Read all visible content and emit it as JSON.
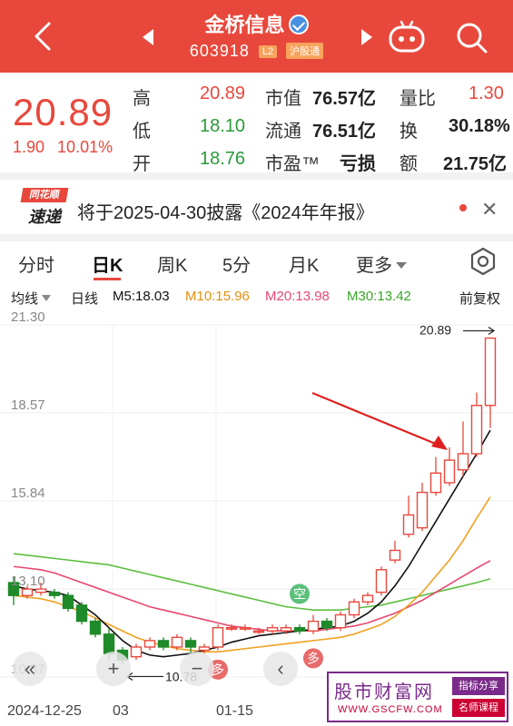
{
  "header": {
    "stock_name": "金桥信息",
    "stock_code": "603918",
    "level_tag": "L2",
    "connect_tag": "沪股通"
  },
  "quote": {
    "price": "20.89",
    "change": "1.90",
    "change_pct": "10.01%",
    "rows": [
      {
        "l1": "高",
        "v1": "20.89",
        "l2": "市值",
        "v2": "76.57亿",
        "l3": "量比",
        "v3": "1.30"
      },
      {
        "l1": "低",
        "v1": "18.10",
        "l2": "流通",
        "v2": "76.51亿",
        "l3": "换",
        "v3": "30.18%"
      },
      {
        "l1": "开",
        "v1": "18.76",
        "l2": "市盈™",
        "v2": "亏损",
        "l3": "额",
        "v3": "21.75亿"
      }
    ]
  },
  "news": {
    "logo_top": "同花顺",
    "logo_bottom": "速递",
    "text": "将于2025-04-30披露《2024年年报》"
  },
  "tabs": [
    "分时",
    "日K",
    "周K",
    "5分",
    "月K",
    "更多"
  ],
  "ma_legend": {
    "mode": "均线",
    "period": "日线",
    "m5": "M5:18.03",
    "m10": "M10:15.96",
    "m20": "M20:13.98",
    "m30": "M30:13.42",
    "adjust": "前复权"
  },
  "colors": {
    "up": "#e8483c",
    "down": "#1f8a2a",
    "m5": "#111111",
    "m10": "#f0a020",
    "m20": "#e84870",
    "m30": "#5cbf40"
  },
  "chart_data": {
    "type": "candlestick",
    "y_ticks": [
      "21.30",
      "18.57",
      "15.84",
      "13.10",
      "10.37"
    ],
    "ylim": [
      10.37,
      21.3
    ],
    "high_label": "20.89",
    "low_label": "10.78",
    "x_labels": [
      "2024-12-25",
      "03",
      "01-15"
    ],
    "markers": [
      "空",
      "多",
      "多"
    ],
    "candles": [
      {
        "o": 13.3,
        "c": 12.9,
        "h": 13.5,
        "l": 12.6
      },
      {
        "o": 12.9,
        "c": 13.1,
        "h": 13.2,
        "l": 12.8
      },
      {
        "o": 13.0,
        "c": 13.1,
        "h": 13.3,
        "l": 12.9
      },
      {
        "o": 13.0,
        "c": 12.9,
        "h": 13.1,
        "l": 12.8
      },
      {
        "o": 12.9,
        "c": 12.5,
        "h": 13.0,
        "l": 12.4
      },
      {
        "o": 12.6,
        "c": 12.1,
        "h": 12.7,
        "l": 12.0
      },
      {
        "o": 12.1,
        "c": 11.7,
        "h": 12.2,
        "l": 11.6
      },
      {
        "o": 11.7,
        "c": 11.1,
        "h": 11.9,
        "l": 10.9
      },
      {
        "o": 11.2,
        "c": 10.9,
        "h": 11.3,
        "l": 10.78
      },
      {
        "o": 11.0,
        "c": 11.3,
        "h": 11.4,
        "l": 10.9
      },
      {
        "o": 11.3,
        "c": 11.5,
        "h": 11.6,
        "l": 11.2
      },
      {
        "o": 11.5,
        "c": 11.3,
        "h": 11.6,
        "l": 11.2
      },
      {
        "o": 11.3,
        "c": 11.6,
        "h": 11.7,
        "l": 11.2
      },
      {
        "o": 11.5,
        "c": 11.3,
        "h": 11.6,
        "l": 11.1
      },
      {
        "o": 11.2,
        "c": 11.3,
        "h": 11.4,
        "l": 11.1
      },
      {
        "o": 11.3,
        "c": 11.9,
        "h": 12.0,
        "l": 11.2
      },
      {
        "o": 11.9,
        "c": 11.9,
        "h": 12.0,
        "l": 11.8
      },
      {
        "o": 11.9,
        "c": 11.9,
        "h": 12.0,
        "l": 11.8
      },
      {
        "o": 11.8,
        "c": 11.8,
        "h": 11.9,
        "l": 11.7
      },
      {
        "o": 11.8,
        "c": 11.9,
        "h": 12.0,
        "l": 11.7
      },
      {
        "o": 11.8,
        "c": 11.9,
        "h": 12.0,
        "l": 11.7
      },
      {
        "o": 11.9,
        "c": 11.8,
        "h": 12.0,
        "l": 11.7
      },
      {
        "o": 11.8,
        "c": 12.1,
        "h": 12.3,
        "l": 11.7
      },
      {
        "o": 12.1,
        "c": 11.9,
        "h": 12.2,
        "l": 11.8
      },
      {
        "o": 11.9,
        "c": 12.3,
        "h": 12.4,
        "l": 11.8
      },
      {
        "o": 12.3,
        "c": 12.7,
        "h": 12.8,
        "l": 12.2
      },
      {
        "o": 12.7,
        "c": 12.9,
        "h": 13.0,
        "l": 12.6
      },
      {
        "o": 13.0,
        "c": 13.7,
        "h": 13.8,
        "l": 12.9
      },
      {
        "o": 14.0,
        "c": 14.3,
        "h": 14.6,
        "l": 13.9
      },
      {
        "o": 14.8,
        "c": 15.4,
        "h": 16.0,
        "l": 14.7
      },
      {
        "o": 15.0,
        "c": 16.1,
        "h": 16.4,
        "l": 14.9
      },
      {
        "o": 16.1,
        "c": 16.7,
        "h": 17.2,
        "l": 16.0
      },
      {
        "o": 16.4,
        "c": 17.1,
        "h": 17.5,
        "l": 16.3
      },
      {
        "o": 16.8,
        "c": 17.3,
        "h": 18.3,
        "l": 16.6
      },
      {
        "o": 17.3,
        "c": 18.8,
        "h": 19.2,
        "l": 17.2
      },
      {
        "o": 18.8,
        "c": 20.89,
        "h": 20.89,
        "l": 18.1
      }
    ],
    "ma5": [
      13.2,
      13.1,
      13.05,
      13.0,
      12.9,
      12.6,
      12.3,
      11.9,
      11.5,
      11.2,
      11.05,
      11.0,
      11.05,
      11.1,
      11.2,
      11.3,
      11.45,
      11.55,
      11.65,
      11.7,
      11.75,
      11.8,
      11.85,
      11.9,
      11.95,
      12.1,
      12.35,
      12.7,
      13.2,
      13.8,
      14.5,
      15.2,
      15.9,
      16.6,
      17.3,
      18.03
    ],
    "ma10": [
      12.9,
      12.85,
      12.8,
      12.7,
      12.55,
      12.4,
      12.2,
      12.0,
      11.8,
      11.6,
      11.45,
      11.35,
      11.25,
      11.2,
      11.15,
      11.15,
      11.2,
      11.25,
      11.3,
      11.35,
      11.4,
      11.45,
      11.5,
      11.55,
      11.6,
      11.7,
      11.85,
      12.0,
      12.25,
      12.6,
      13.0,
      13.5,
      14.0,
      14.6,
      15.3,
      15.96
    ],
    "ma20": [
      13.8,
      13.75,
      13.7,
      13.6,
      13.45,
      13.3,
      13.15,
      13.0,
      12.85,
      12.7,
      12.55,
      12.45,
      12.35,
      12.25,
      12.15,
      12.05,
      11.95,
      11.9,
      11.85,
      11.8,
      11.8,
      11.8,
      11.8,
      11.85,
      11.9,
      11.95,
      12.05,
      12.2,
      12.35,
      12.55,
      12.75,
      13.0,
      13.25,
      13.5,
      13.75,
      13.98
    ],
    "ma30": [
      14.2,
      14.15,
      14.1,
      14.05,
      14.0,
      13.95,
      13.9,
      13.85,
      13.75,
      13.65,
      13.55,
      13.45,
      13.35,
      13.25,
      13.15,
      13.05,
      12.95,
      12.85,
      12.75,
      12.65,
      12.55,
      12.5,
      12.45,
      12.45,
      12.45,
      12.5,
      12.55,
      12.6,
      12.7,
      12.8,
      12.9,
      13.0,
      13.1,
      13.2,
      13.3,
      13.42
    ]
  },
  "controls": {
    "collapse": "«",
    "zoom_in": "+",
    "zoom_out": "−",
    "prev": "‹",
    "next": "›"
  },
  "watermark": {
    "title": "股市财富网",
    "url": "WWW.GSCFW.COM",
    "badge1": "指标分享",
    "badge2": "名师课程"
  }
}
